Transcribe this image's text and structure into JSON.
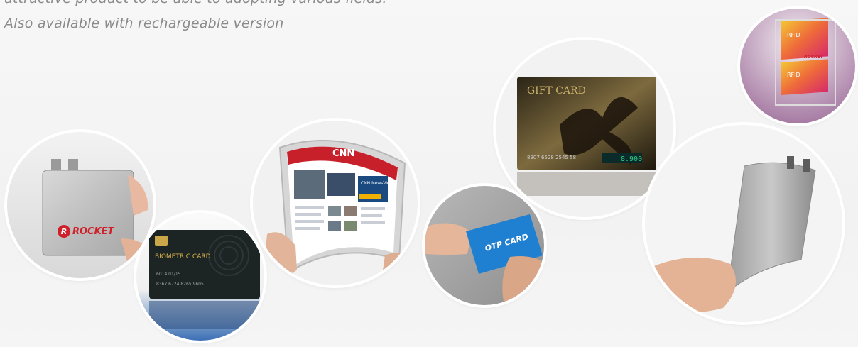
{
  "captions": {
    "line1": "attractive product to be able to adopting various fields.",
    "line2": "Also available with rechargeable version"
  },
  "products": [
    {
      "name": "pouch-battery",
      "logo_text": "ROCKET"
    },
    {
      "name": "biometric-card",
      "card_title": "BIOMETRIC CARD",
      "card_line1": "6014   01/15",
      "card_number": "8367 6724 8265 9605"
    },
    {
      "name": "flexible-display",
      "site_logo": "CNN",
      "side_title": "CNN NewsView"
    },
    {
      "name": "otp-card",
      "card_title": "OTP CARD"
    },
    {
      "name": "gift-card",
      "card_title": "GIFT CARD",
      "card_number": "8907 6528 2545 58",
      "display_value": "8.900"
    },
    {
      "name": "rfid-tag",
      "tag_label_1": "RFID",
      "tag_label_2": "RFID",
      "logo_text": "ROCKET"
    },
    {
      "name": "flexible-battery"
    }
  ],
  "colors": {
    "background": "#f4f4f4",
    "caption": "#8a8a8a",
    "rocket_red": "#d0202a",
    "otp_blue": "#1f7fd0"
  }
}
